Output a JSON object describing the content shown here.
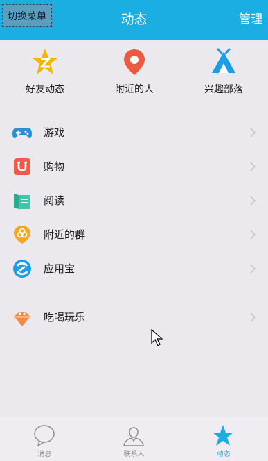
{
  "header": {
    "menu_toggle_label": "切换菜单",
    "title": "动态",
    "manage_label": "管理"
  },
  "quick_entries": [
    {
      "label": "好友动态",
      "icon": "qzone-star-icon",
      "color": "#f5b400"
    },
    {
      "label": "附近的人",
      "icon": "location-pin-icon",
      "color": "#ee5a3f"
    },
    {
      "label": "兴趣部落",
      "icon": "tribe-tent-icon",
      "color": "#1a9de6"
    }
  ],
  "menu": [
    {
      "label": "游戏",
      "icon": "gamepad-icon",
      "color": "#2b8ed6"
    },
    {
      "label": "购物",
      "icon": "shopping-bag-icon",
      "color": "#ef5b46"
    },
    {
      "label": "阅读",
      "icon": "book-icon",
      "color": "#3ec6a8"
    },
    {
      "label": "附近的群",
      "icon": "nearby-group-icon",
      "color": "#f5a623"
    },
    {
      "label": "应用宝",
      "icon": "app-store-icon",
      "color": "#1a9de6"
    },
    {
      "label": "吃喝玩乐",
      "icon": "ice-cream-icon",
      "color": "#f58a3c"
    }
  ],
  "tabbar": [
    {
      "label": "消息",
      "icon": "message-bubble-icon",
      "active": false
    },
    {
      "label": "联系人",
      "icon": "contacts-icon",
      "active": false
    },
    {
      "label": "动态",
      "icon": "star-icon",
      "active": true
    }
  ],
  "colors": {
    "accent": "#1aaee3",
    "background": "#ebe9ee"
  }
}
